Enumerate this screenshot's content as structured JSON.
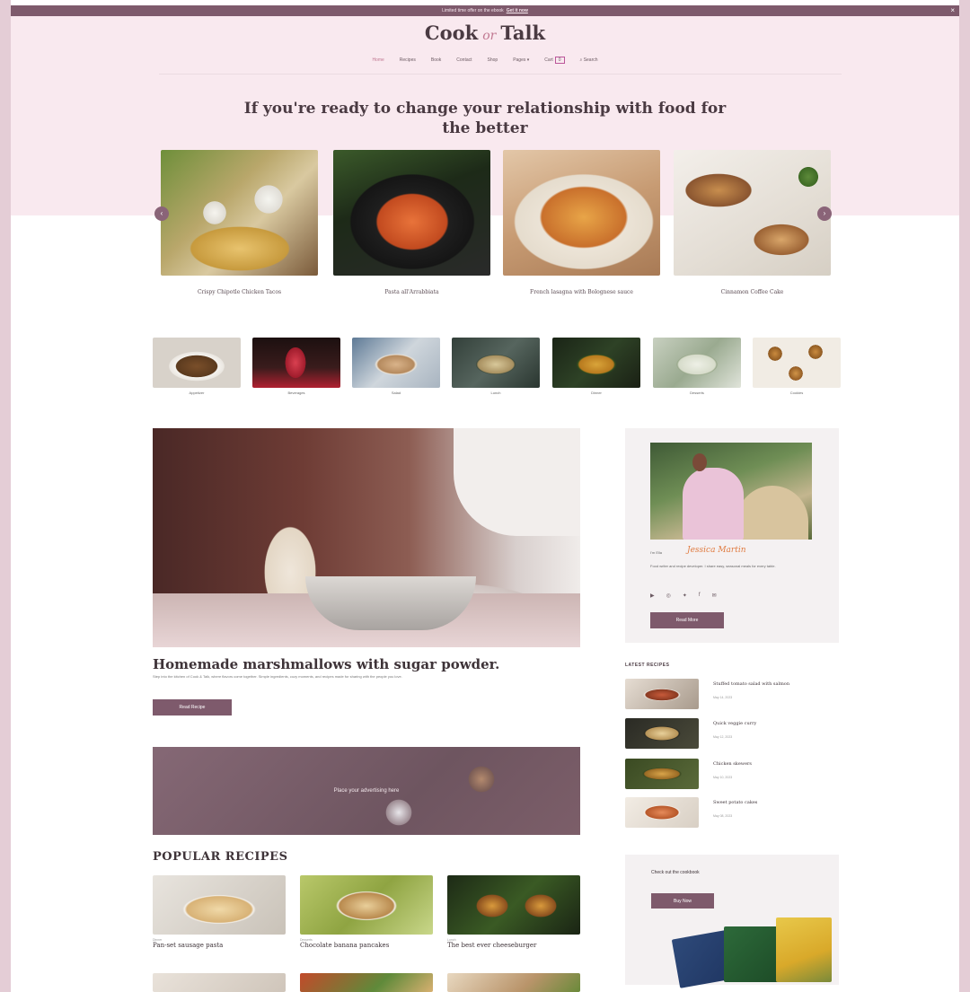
{
  "topbar": {
    "text": "Limited time offer on the ebook",
    "link": "Get it now",
    "close": "×"
  },
  "site": {
    "logo_part1": "Cook",
    "logo_amp": "or",
    "logo_part2": "Talk"
  },
  "nav": {
    "items": [
      "Home",
      "Recipes",
      "Book",
      "Contact",
      "Shop",
      "Pages ▾",
      "Cart"
    ],
    "cart_count": "0",
    "search": "⌕ Search"
  },
  "hero": {
    "headline": "If you're ready to change your relationship with food for the better"
  },
  "carousel": {
    "prev": "‹",
    "next": "›",
    "items": [
      {
        "title": "Crispy Chipotle Chicken Tacos"
      },
      {
        "title": "Pasta all'Arrabbiata"
      },
      {
        "title": "French lasagna with Bolognese sauce"
      },
      {
        "title": "Cinnamon Coffee Cake"
      }
    ]
  },
  "categories": [
    "Appetizer",
    "Beverages",
    "Salad",
    "Lunch",
    "Dinner",
    "Desserts",
    "Cookies"
  ],
  "featured": {
    "title": "Homemade marshmallows with sugar powder.",
    "excerpt": "Step into the kitchen of Cook & Talk, where flavors come together. Simple ingredients, cozy moments, and recipes made for sharing with the people you love.",
    "button": "Read Recipe"
  },
  "ad": {
    "text": "Place your advertising here"
  },
  "popular": {
    "title": "POPULAR RECIPES",
    "items": [
      {
        "tag": "Dinner",
        "title": "Pan-set sausage pasta"
      },
      {
        "tag": "Desserts",
        "title": "Chocolate banana pancakes"
      },
      {
        "tag": "Lunch",
        "title": "The best ever cheeseburger"
      }
    ]
  },
  "author": {
    "greeting": "I'm Ella",
    "signature": "Jessica Martin",
    "bio": "Food writer and recipe developer. I share easy, seasonal meals for every table.",
    "socials": [
      "▶",
      "◎",
      "✦",
      "f",
      "✉"
    ],
    "button": "Read More"
  },
  "latest": {
    "title": "LATEST RECIPES",
    "items": [
      {
        "title": "Stuffed tomato salad with salmon",
        "date": "May 14, 2023"
      },
      {
        "title": "Quick veggie curry",
        "date": "May 12, 2023"
      },
      {
        "title": "Chicken skewers",
        "date": "May 10, 2023"
      },
      {
        "title": "Sweet potato cakes",
        "date": "May 08, 2023"
      }
    ]
  },
  "cookbook": {
    "text": "Check out the cookbook",
    "button": "Buy Now"
  },
  "colors": {
    "accent": "#7e5a6c",
    "hero_bg": "#f9e9ef",
    "page_bg": "#e4cdd6"
  }
}
